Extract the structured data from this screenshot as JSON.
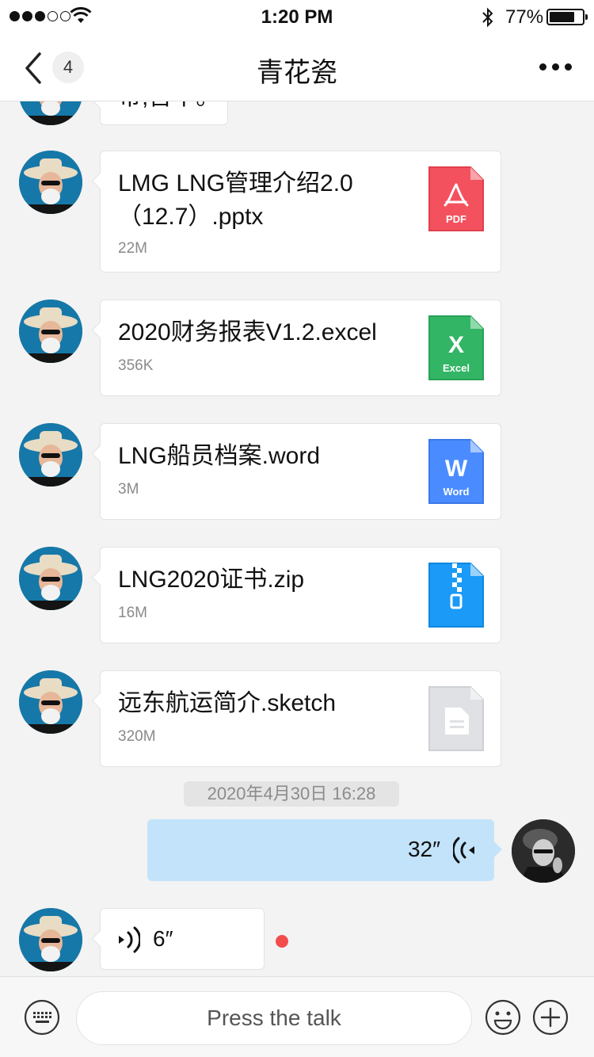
{
  "status_bar": {
    "signal_icon": "signal-icon",
    "wifi_icon": "wifi-icon",
    "time": "1:20 PM",
    "bluetooth_icon": "bluetooth-icon",
    "battery_percent": "77%",
    "battery_level": 0.77
  },
  "header": {
    "back_icon": "chevron-left-icon",
    "unread_count": "4",
    "title": "青花瓷",
    "more_icon": "more-horizontal-icon"
  },
  "messages": {
    "partial_text": "带,吾中。",
    "files": [
      {
        "name": "LMG LNG管理介绍2.0（12.7）.pptx",
        "size": "22M",
        "icon_label": "PDF",
        "icon": "pdf-icon",
        "color": "#f4515e"
      },
      {
        "name": "2020财务报表V1.2.excel",
        "size": "356K",
        "icon_label": "Excel",
        "icon_glyph": "X",
        "icon": "excel-icon",
        "color": "#33b566"
      },
      {
        "name": "LNG船员档案.word",
        "size": "3M",
        "icon_label": "Word",
        "icon_glyph": "W",
        "icon": "word-icon",
        "color": "#4a8cff"
      },
      {
        "name": "LNG2020证书.zip",
        "size": "16M",
        "icon": "zip-icon",
        "color": "#1b9af7"
      },
      {
        "name": "远东航运简介.sketch",
        "size": "320M",
        "icon": "generic-file-icon",
        "color": "#dfe1e4"
      }
    ],
    "timestamp": "2020年4月30日 16:28",
    "outgoing_voice": {
      "duration": "32″",
      "icon": "voice-wave-icon"
    },
    "incoming_voice": {
      "duration": "6″",
      "icon": "voice-wave-icon",
      "unread_color": "#f24d4d"
    }
  },
  "input_bar": {
    "keyboard_icon": "keyboard-icon",
    "talk_label": "Press the talk",
    "emoji_icon": "emoji-icon",
    "plus_icon": "plus-icon"
  }
}
